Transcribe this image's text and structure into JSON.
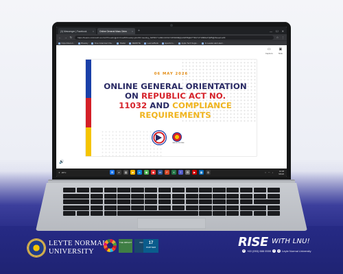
{
  "browser": {
    "tabs": [
      {
        "label": "(3) Messenger | Facebook",
        "active": false
      },
      {
        "label": "Online General Mass Orien",
        "active": true
      }
    ],
    "url": "https://teams.microsoft.com/v2/?meetingjoin=true#/l/meetup-join/19:meeting_NWNhYmJlZmUtOGY2OS00MjQxLWI5NjEtYTM1Y2Y2MDk2YjM5@thread.v2/0",
    "bookmarks": [
      "https://docs.li...",
      "Bluesky",
      "Free Grammar Che...",
      "Padlet",
      "REMOTE",
      "LearnerBank",
      "Eperform...",
      "Apple Tech Sugto...",
      "In-Leader-alert-alert..."
    ]
  },
  "viewer": {
    "tools": [
      {
        "icon": "captions-icon",
        "label": "Captions"
      },
      {
        "icon": "slide-icon",
        "label": "Slide"
      }
    ]
  },
  "slide": {
    "date": "06 MAY 2026",
    "title_line1": "ONLINE GENERAL ORIENTATION",
    "title_line2a": "ON ",
    "title_line2b": "REPUBLIC ACT NO.",
    "title_line3a": "11032",
    "title_line3b": " AND ",
    "title_line3c": "COMPLIANCE",
    "title_line4": "REQUIREMENTS",
    "logo_b_caption": "BAGONG PILIPINAS"
  },
  "taskbar": {
    "weather": "29°C",
    "time": "10:38",
    "date": "5/6/26"
  },
  "footer": {
    "university_line1": "LEYTE NORMAL",
    "university_line2": "UNIVERSITY",
    "badges": [
      {
        "num": "",
        "text": "THE IMPACT"
      },
      {
        "num": "",
        "text": "ISO"
      },
      {
        "num": "17",
        "text": "PARTNER"
      }
    ],
    "rise": "RISE",
    "with_lnu": "WITH LNU!",
    "phone": "+63 (053) 888 0559",
    "social": "Leyte Normal University"
  },
  "colors": {
    "navy": "#2a2a64",
    "red": "#d6232b",
    "gold": "#f0b41e",
    "date_orange": "#e38b12",
    "footer_blue": "#1f2373"
  }
}
